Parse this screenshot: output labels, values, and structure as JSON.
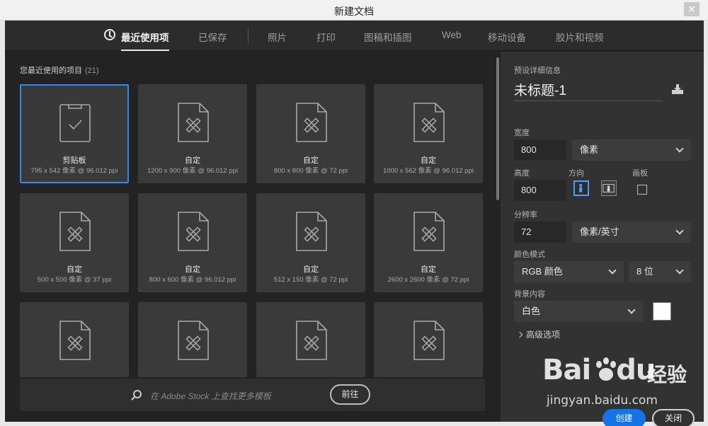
{
  "window": {
    "title": "新建文档",
    "close_glyph": "✕"
  },
  "tabs": [
    {
      "label": "最近使用项",
      "active": true,
      "icon": "clock-icon"
    },
    {
      "label": "已保存"
    },
    {
      "label": "照片"
    },
    {
      "label": "打印"
    },
    {
      "label": "图稿和插图"
    },
    {
      "label": "Web"
    },
    {
      "label": "移动设备"
    },
    {
      "label": "胶片和视频"
    }
  ],
  "recent": {
    "title": "您最近使用的项目",
    "count": "(21)",
    "tiles": [
      {
        "name": "剪贴板",
        "dims": "795 x 542 像素 @ 96.012 ppi",
        "icon": "clipboard-check-icon",
        "selected": true
      },
      {
        "name": "自定",
        "dims": "1200 x 900 像素 @ 96.012 ppi",
        "icon": "custom-document-icon"
      },
      {
        "name": "自定",
        "dims": "800 x 800 像素 @ 72 ppi",
        "icon": "custom-document-icon"
      },
      {
        "name": "自定",
        "dims": "1000 x 562 像素 @ 96.012 ppi",
        "icon": "custom-document-icon"
      },
      {
        "name": "自定",
        "dims": "500 x 500 像素 @ 37 ppi",
        "icon": "custom-document-icon"
      },
      {
        "name": "自定",
        "dims": "800 x 600 像素 @ 96.012 ppi",
        "icon": "custom-document-icon"
      },
      {
        "name": "自定",
        "dims": "512 x 150 像素 @ 72 ppi",
        "icon": "custom-document-icon"
      },
      {
        "name": "自定",
        "dims": "2600 x 2600 像素 @ 72 ppi",
        "icon": "custom-document-icon"
      },
      {
        "name": "",
        "dims": "",
        "icon": "custom-document-icon"
      },
      {
        "name": "",
        "dims": "",
        "icon": "custom-document-icon"
      },
      {
        "name": "",
        "dims": "",
        "icon": "custom-document-icon"
      },
      {
        "name": "",
        "dims": "",
        "icon": "custom-document-icon"
      }
    ]
  },
  "stock": {
    "placeholder": "在 Adobe Stock 上查找更多模板",
    "go_label": "前往"
  },
  "details": {
    "section_title": "预设详细信息",
    "doc_name": "未标题-1",
    "width_label": "宽度",
    "width_value": "800",
    "width_unit": "像素",
    "height_label": "高度",
    "height_value": "800",
    "orientation_label": "方向",
    "artboard_label": "画板",
    "resolution_label": "分辨率",
    "resolution_value": "72",
    "resolution_unit": "像素/英寸",
    "color_mode_label": "颜色模式",
    "color_mode": "RGB 颜色",
    "bit_depth": "8 位",
    "background_label": "背景内容",
    "background_value": "白色",
    "background_color": "#ffffff",
    "advanced_label": "高级选项",
    "create_label": "创建",
    "close_label": "关闭"
  },
  "watermark": {
    "brand": "Bai",
    "brand2": "du",
    "cn": "经验",
    "url": "jingyan.baidu.com"
  },
  "colors": {
    "accent": "#1473e6",
    "selection": "#2d8ceb"
  }
}
